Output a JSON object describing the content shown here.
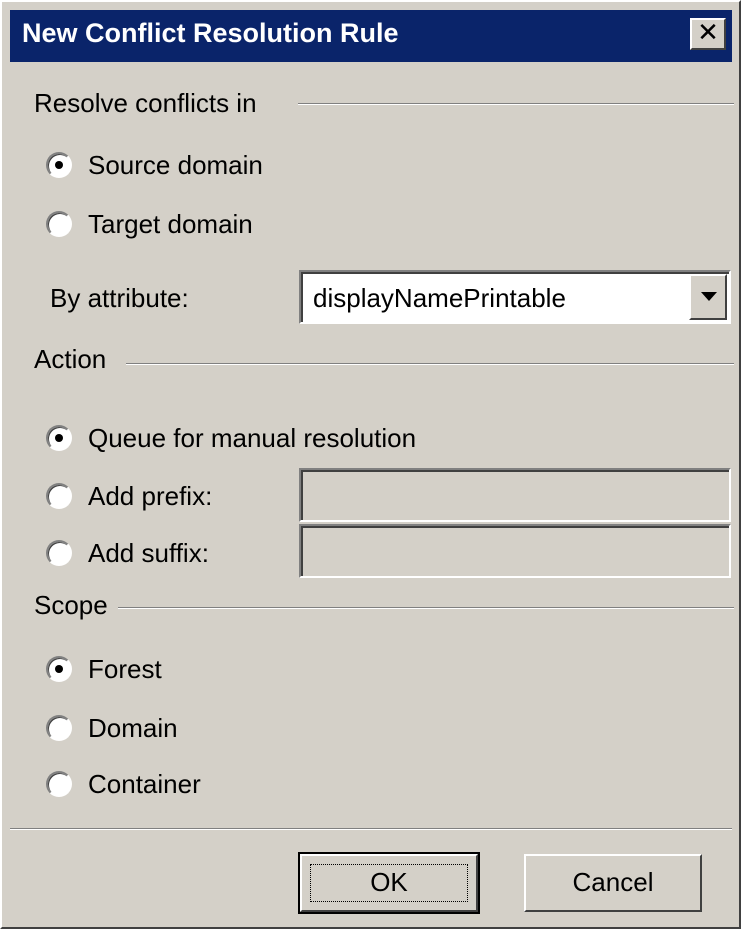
{
  "dialog": {
    "title": "New Conflict Resolution Rule",
    "close_label": "✕"
  },
  "resolve_group": {
    "label": "Resolve conflicts in",
    "options": [
      {
        "label": "Source domain",
        "selected": true
      },
      {
        "label": "Target domain",
        "selected": false
      }
    ],
    "attribute_label": "By attribute:",
    "attribute_value": "displayNamePrintable"
  },
  "action_group": {
    "label": "Action",
    "options": [
      {
        "label": "Queue for manual resolution",
        "selected": true
      },
      {
        "label": "Add prefix:",
        "selected": false,
        "field_value": ""
      },
      {
        "label": "Add suffix:",
        "selected": false,
        "field_value": ""
      }
    ]
  },
  "scope_group": {
    "label": "Scope",
    "options": [
      {
        "label": "Forest",
        "selected": true
      },
      {
        "label": "Domain",
        "selected": false
      },
      {
        "label": "Container",
        "selected": false
      }
    ]
  },
  "buttons": {
    "ok_label": "OK",
    "cancel_label": "Cancel"
  }
}
